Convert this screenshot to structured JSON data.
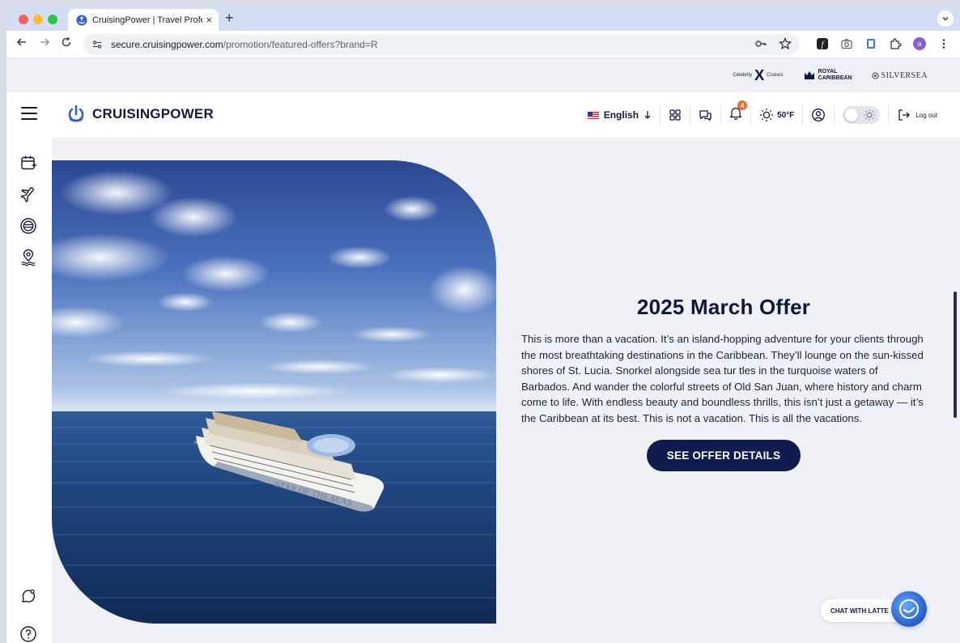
{
  "browser": {
    "tab_title": "CruisingPower | Travel Profes",
    "tab_close": "×",
    "new_tab": "+",
    "url_host": "secure.cruisingpower.com",
    "url_path": "/promotion/featured-offers?brand=R",
    "profile_initial": "a"
  },
  "brands": {
    "celebrity_left": "Celebrity",
    "celebrity_x": "X",
    "celebrity_right": "Cruises",
    "royal_line1": "ROYAL",
    "royal_line2": "CARIBBEAN",
    "silversea": "SILVERSEA"
  },
  "header": {
    "logo_text": "CRUISINGPOWER",
    "language": "English",
    "notifications_count": "4",
    "temperature": "50°F",
    "logout_label": "Log out"
  },
  "hero": {
    "title": "2025 March Offer",
    "body": "This is more than a vacation. It’s an island-hopping adventure for your clients through the most breathtaking destinations in the Caribbean. They’ll lounge on the sun-kissed shores of St. Lucia. Snorkel alongside sea tur tles in the turquoise waters of Barbados. And wander the colorful streets of Old San Juan, where history and charm come to life. With endless beauty and boundless thrills, this isn’t just a getaway — it’s the Caribbean at its best. This is not a vacation. This is all the vacations.",
    "cta_label": "SEE OFFER DETAILS",
    "ship_name_text": "STAR OF THE SEAS"
  },
  "chat": {
    "label": "CHAT WITH LATTE"
  },
  "colors": {
    "brand_navy": "#0f1c4f",
    "badge_orange": "#ee6a2f",
    "page_bg": "#eff1f7"
  }
}
